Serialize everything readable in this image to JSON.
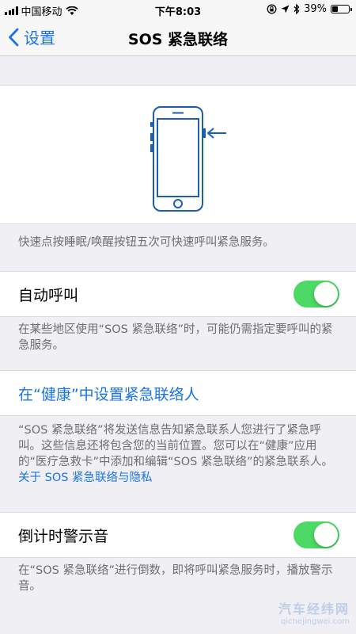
{
  "status_bar": {
    "carrier": "中国移动",
    "time": "下午8:03",
    "battery_percent": "39%",
    "battery_level": 0.39
  },
  "nav": {
    "back_label": "设置",
    "title": "SOS 紧急联络"
  },
  "intro": {
    "description": "快速点按睡眠/唤醒按钮五次可快速呼叫紧急服务。"
  },
  "auto_call": {
    "label": "自动呼叫",
    "enabled": true,
    "footer": "在某些地区使用“SOS 紧急联络”时，可能仍需指定要呼叫的紧急服务。"
  },
  "health": {
    "link_label": "在“健康”中设置紧急联络人",
    "footer": "“SOS 紧急联络”将发送信息告知紧急联系人您进行了紧急呼叫。这些信息还将包含您的当前位置。您可以在“健康”应用的“医疗急救卡”中添加和编辑“SOS 紧急联络”的紧急联系人。",
    "privacy_link": "关于 SOS 紧急联络与隐私"
  },
  "countdown": {
    "label": "倒计时警示音",
    "enabled": true,
    "footer": "在“SOS 紧急联络”进行倒数，即将呼叫紧急服务时，播放警示音。"
  },
  "watermark": {
    "main": "汽车经纬网",
    "sub": "qichejingwei.com"
  },
  "colors": {
    "accent": "#1a73e8",
    "toggle_on": "#4cd964",
    "background": "#efeff4"
  }
}
